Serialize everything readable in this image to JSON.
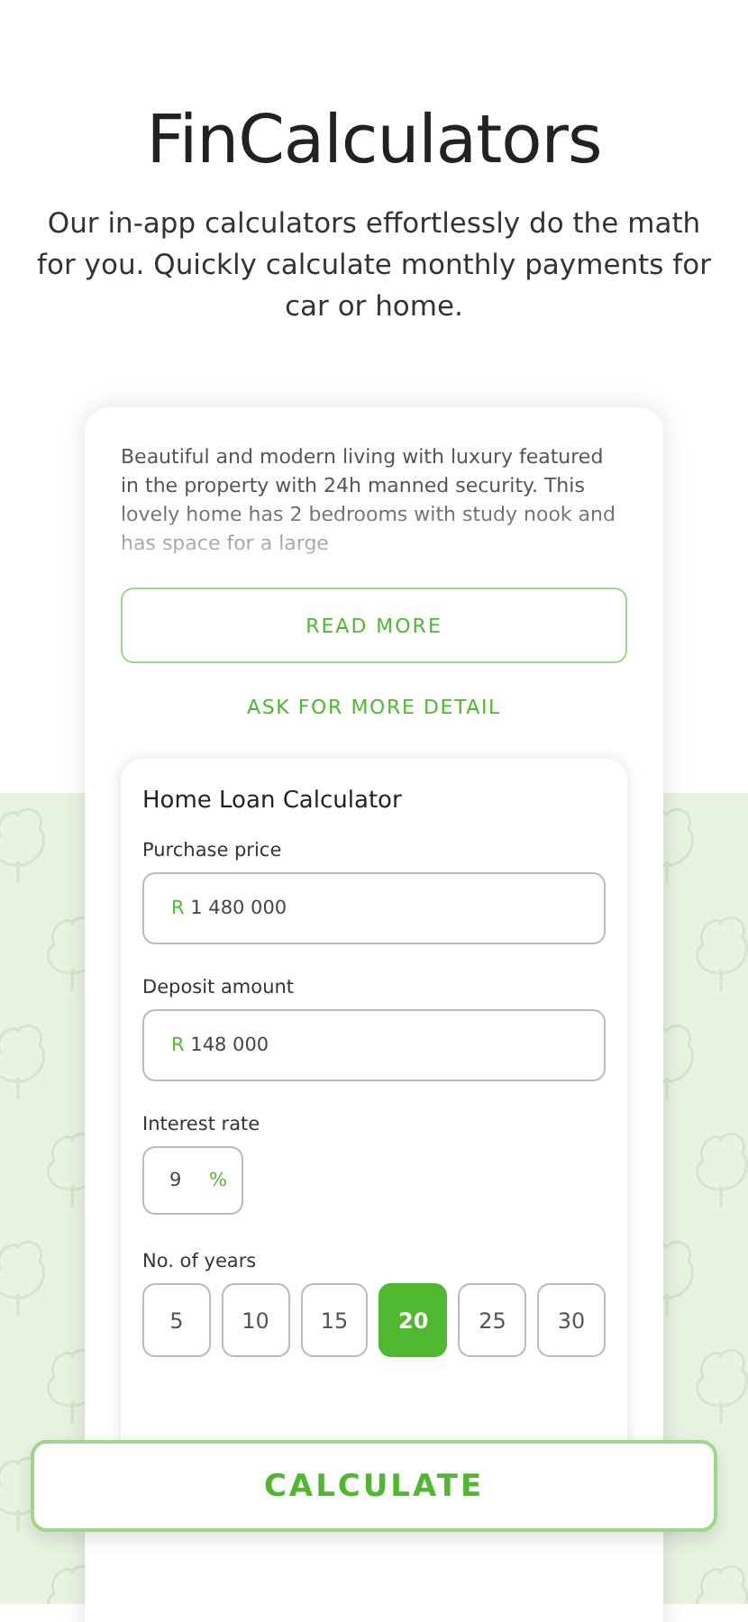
{
  "header": {
    "title": "FinCalculators",
    "subtitle": "Our in-app calculators effortlessly do the math for you. Quickly calculate monthly payments for car or home."
  },
  "listing": {
    "description": "Beautiful and modern living with luxury featured in the property with 24h manned security. This lovely home has 2 bedrooms with study nook and has space for a large",
    "read_more": "READ MORE",
    "ask_detail": "ASK FOR MORE DETAIL"
  },
  "calculator": {
    "title": "Home Loan Calculator",
    "fields": [
      {
        "label": "Purchase price",
        "prefix": "R",
        "value": "1 480 000"
      },
      {
        "label": "Deposit amount",
        "prefix": "R",
        "value": "148 000"
      }
    ],
    "interest": {
      "label": "Interest rate",
      "value": "9",
      "suffix": "%"
    },
    "years": {
      "label": "No. of years",
      "options": [
        {
          "label": "5",
          "selected": false
        },
        {
          "label": "10",
          "selected": false
        },
        {
          "label": "15",
          "selected": false
        },
        {
          "label": "20",
          "selected": true
        },
        {
          "label": "25",
          "selected": false
        },
        {
          "label": "30",
          "selected": false
        }
      ]
    }
  },
  "calculate_button": "CALCULATE"
}
